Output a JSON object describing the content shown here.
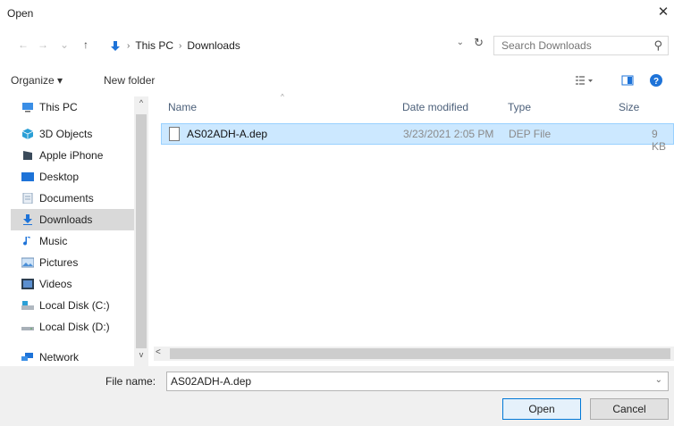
{
  "window": {
    "title": "Open",
    "close_glyph": "✕"
  },
  "address": {
    "crumbs": [
      "This PC",
      "Downloads"
    ],
    "search_placeholder": "Search Downloads"
  },
  "toolbar": {
    "organize_label": "Organize ▾",
    "new_folder_label": "New folder"
  },
  "sidebar": {
    "items": [
      {
        "label": "This PC",
        "icon": "pc-icon"
      },
      {
        "label": "3D Objects",
        "icon": "cube-icon"
      },
      {
        "label": "Apple iPhone",
        "icon": "phone-icon"
      },
      {
        "label": "Desktop",
        "icon": "desktop-icon"
      },
      {
        "label": "Documents",
        "icon": "documents-icon"
      },
      {
        "label": "Downloads",
        "icon": "download-icon",
        "selected": true
      },
      {
        "label": "Music",
        "icon": "music-icon"
      },
      {
        "label": "Pictures",
        "icon": "pictures-icon"
      },
      {
        "label": "Videos",
        "icon": "videos-icon"
      },
      {
        "label": "Local Disk (C:)",
        "icon": "drive-icon"
      },
      {
        "label": "Local Disk (D:)",
        "icon": "drive-icon"
      },
      {
        "label": "Network",
        "icon": "network-icon"
      }
    ]
  },
  "filelist": {
    "columns": {
      "name": "Name",
      "date": "Date modified",
      "type": "Type",
      "size": "Size"
    },
    "rows": [
      {
        "name": "AS02ADH-A.dep",
        "date": "3/23/2021 2:05 PM",
        "type": "DEP File",
        "size": "9 KB"
      }
    ]
  },
  "bottom": {
    "file_name_label": "File name:",
    "file_name_value": "AS02ADH-A.dep",
    "open_label": "Open",
    "cancel_label": "Cancel"
  },
  "colors": {
    "selection_bg": "#cce8ff",
    "selection_border": "#99d1ff",
    "accent": "#0078d7",
    "column_header": "#4c607a"
  }
}
